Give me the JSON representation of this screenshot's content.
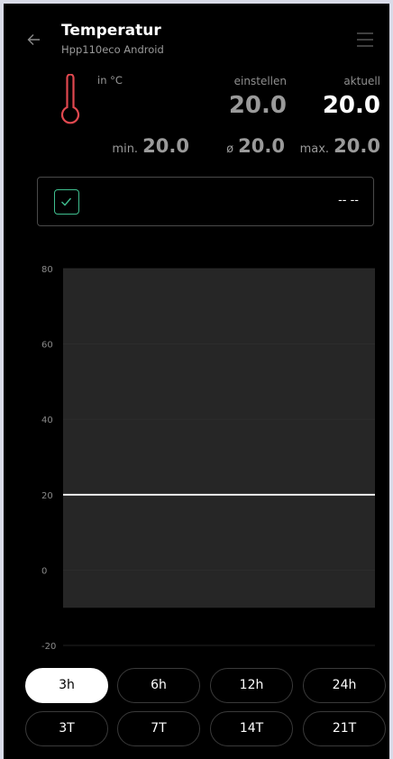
{
  "header": {
    "title": "Temperatur",
    "subtitle": "Hpp110eco Android"
  },
  "reading": {
    "unit": "in °C",
    "set_label": "einstellen",
    "set_value": "20.0",
    "current_label": "aktuell",
    "current_value": "20.0"
  },
  "stats": {
    "min_label": "min.",
    "min_value": "20.0",
    "avg_label": "ø",
    "avg_value": "20.0",
    "max_label": "max.",
    "max_value": "20.0"
  },
  "status": {
    "checked": true,
    "value": "-- --"
  },
  "colors": {
    "background": "#000000",
    "thermometer": "#e0484f",
    "check": "#3fbf8f",
    "plot_area": "#262626",
    "line": "#ffffff"
  },
  "icons": {
    "back": "arrow-left-icon",
    "menu": "hamburger-menu-icon",
    "thermometer": "thermometer-icon",
    "check": "checkmark-icon"
  },
  "chart_data": {
    "type": "line",
    "title": "",
    "xlabel": "",
    "ylabel": "",
    "ylim": [
      -20,
      80
    ],
    "y_ticks": [
      80,
      60,
      40,
      20,
      0,
      -20
    ],
    "grid": true,
    "x": [
      0,
      1
    ],
    "series": [
      {
        "values": [
          20.0,
          20.0
        ]
      }
    ]
  },
  "ranges": {
    "row1": [
      "3h",
      "6h",
      "12h",
      "24h"
    ],
    "row2": [
      "3T",
      "7T",
      "14T",
      "21T"
    ],
    "selected": "3h"
  }
}
